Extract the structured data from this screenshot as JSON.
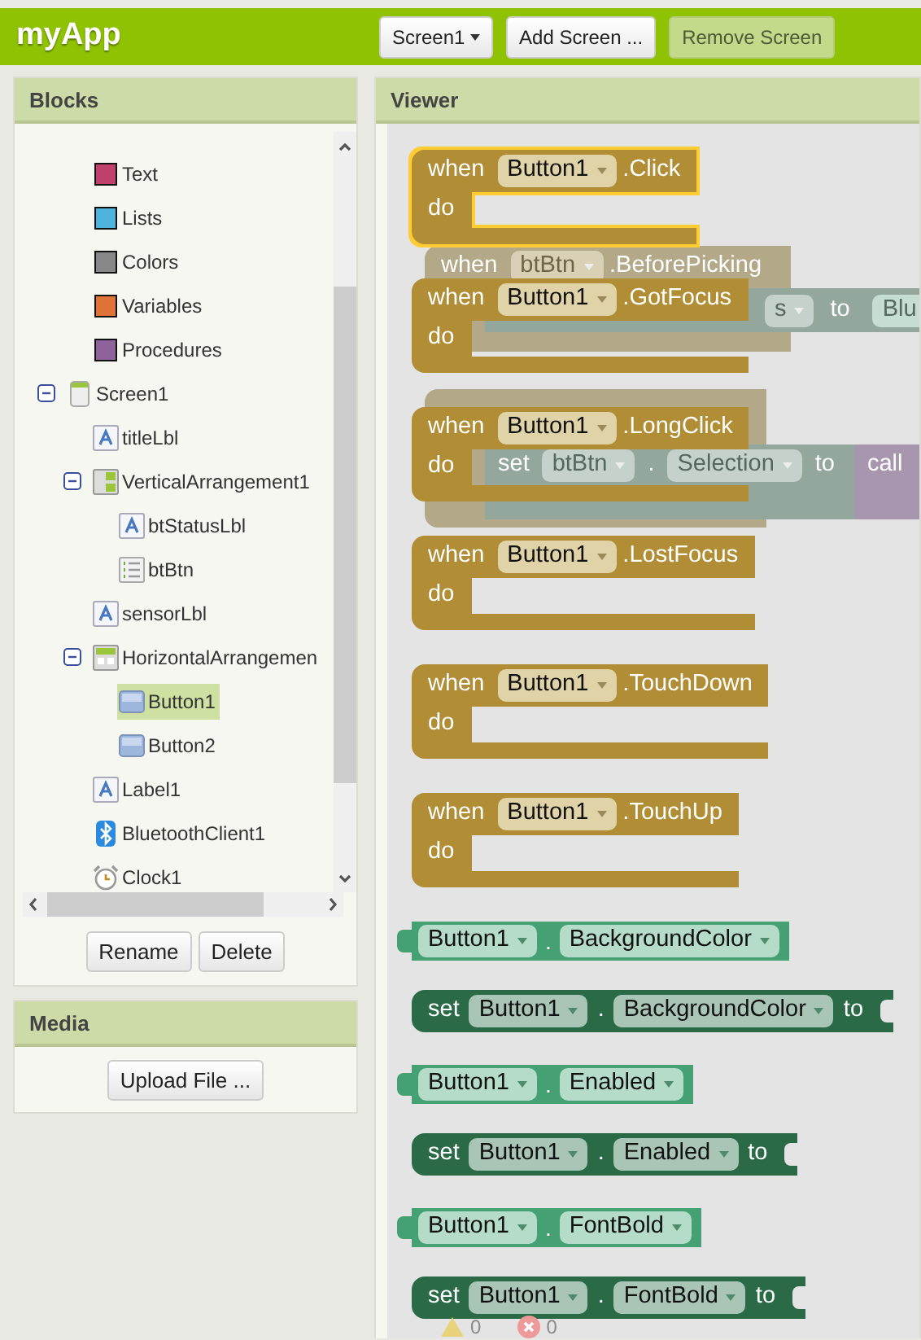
{
  "app_title": "myApp",
  "toolbar": {
    "screen_select": "Screen1",
    "buttons": [
      {
        "label": "Add Screen ...",
        "disabled": false
      },
      {
        "label": "Remove Screen",
        "disabled": true
      }
    ]
  },
  "blocks_panel": {
    "title": "Blocks",
    "tree": [
      {
        "label": "Text",
        "kind": "builtin",
        "color": "#c0416b",
        "selected": false
      },
      {
        "label": "Lists",
        "kind": "builtin",
        "color": "#4fb3de",
        "selected": false
      },
      {
        "label": "Colors",
        "kind": "builtin",
        "color": "#888888",
        "selected": false
      },
      {
        "label": "Variables",
        "kind": "builtin",
        "color": "#e07338",
        "selected": false
      },
      {
        "label": "Procedures",
        "kind": "builtin",
        "color": "#8d6399",
        "selected": false
      },
      {
        "label": "Screen1",
        "kind": "screen",
        "selected": false,
        "expanded": true,
        "children": [
          {
            "label": "titleLbl",
            "kind": "label",
            "selected": false
          },
          {
            "label": "VerticalArrangement1",
            "kind": "vertical",
            "selected": false,
            "expanded": true,
            "children": [
              {
                "label": "btStatusLbl",
                "kind": "label",
                "selected": false
              },
              {
                "label": "btBtn",
                "kind": "listpicker",
                "selected": false
              }
            ]
          },
          {
            "label": "sensorLbl",
            "kind": "label",
            "selected": false
          },
          {
            "label": "HorizontalArrangemen",
            "kind": "horizontal",
            "selected": false,
            "expanded": true,
            "children": [
              {
                "label": "Button1",
                "kind": "button",
                "selected": true
              },
              {
                "label": "Button2",
                "kind": "button",
                "selected": false
              }
            ]
          },
          {
            "label": "Label1",
            "kind": "label",
            "selected": false
          },
          {
            "label": "BluetoothClient1",
            "kind": "bluetooth",
            "selected": false
          },
          {
            "label": "Clock1",
            "kind": "clock",
            "selected": false
          }
        ]
      }
    ],
    "buttons": [
      "Rename",
      "Delete"
    ]
  },
  "media_panel": {
    "title": "Media",
    "button": "Upload File ..."
  },
  "viewer": {
    "title": "Viewer",
    "workspace_blocks": [
      {
        "kind": "event",
        "texts": [
          "when",
          "btBtn",
          ".BeforePicking"
        ]
      },
      {
        "kind": "setter-tail",
        "texts": [
          "s",
          "to",
          "Blu"
        ]
      },
      {
        "kind": "event-hidden"
      },
      {
        "kind": "setter-call",
        "texts": [
          "set",
          "btBtn",
          ".",
          "Selection",
          "to",
          "call"
        ]
      }
    ],
    "flyout": [
      {
        "kind": "event",
        "keyword": "when",
        "component": "Button1",
        "event": ".Click",
        "do": "do",
        "selected": true
      },
      {
        "kind": "event",
        "keyword": "when",
        "component": "Button1",
        "event": ".GotFocus",
        "do": "do",
        "selected": false
      },
      {
        "kind": "event",
        "keyword": "when",
        "component": "Button1",
        "event": ".LongClick",
        "do": "do",
        "selected": false
      },
      {
        "kind": "event",
        "keyword": "when",
        "component": "Button1",
        "event": ".LostFocus",
        "do": "do",
        "selected": false
      },
      {
        "kind": "event",
        "keyword": "when",
        "component": "Button1",
        "event": ".TouchDown",
        "do": "do",
        "selected": false
      },
      {
        "kind": "event",
        "keyword": "when",
        "component": "Button1",
        "event": ".TouchUp",
        "do": "do",
        "selected": false
      },
      {
        "kind": "getter",
        "component": "Button1",
        "dot": ".",
        "property": "BackgroundColor"
      },
      {
        "kind": "setter",
        "keyword": "set",
        "component": "Button1",
        "dot": ".",
        "property": "BackgroundColor",
        "to": "to"
      },
      {
        "kind": "getter",
        "component": "Button1",
        "dot": ".",
        "property": "Enabled"
      },
      {
        "kind": "setter",
        "keyword": "set",
        "component": "Button1",
        "dot": ".",
        "property": "Enabled",
        "to": "to"
      },
      {
        "kind": "getter",
        "component": "Button1",
        "dot": ".",
        "property": "FontBold"
      },
      {
        "kind": "setter",
        "keyword": "set",
        "component": "Button1",
        "dot": ".",
        "property": "FontBold",
        "to": "to"
      }
    ],
    "warnings": "0",
    "errors": "0"
  }
}
